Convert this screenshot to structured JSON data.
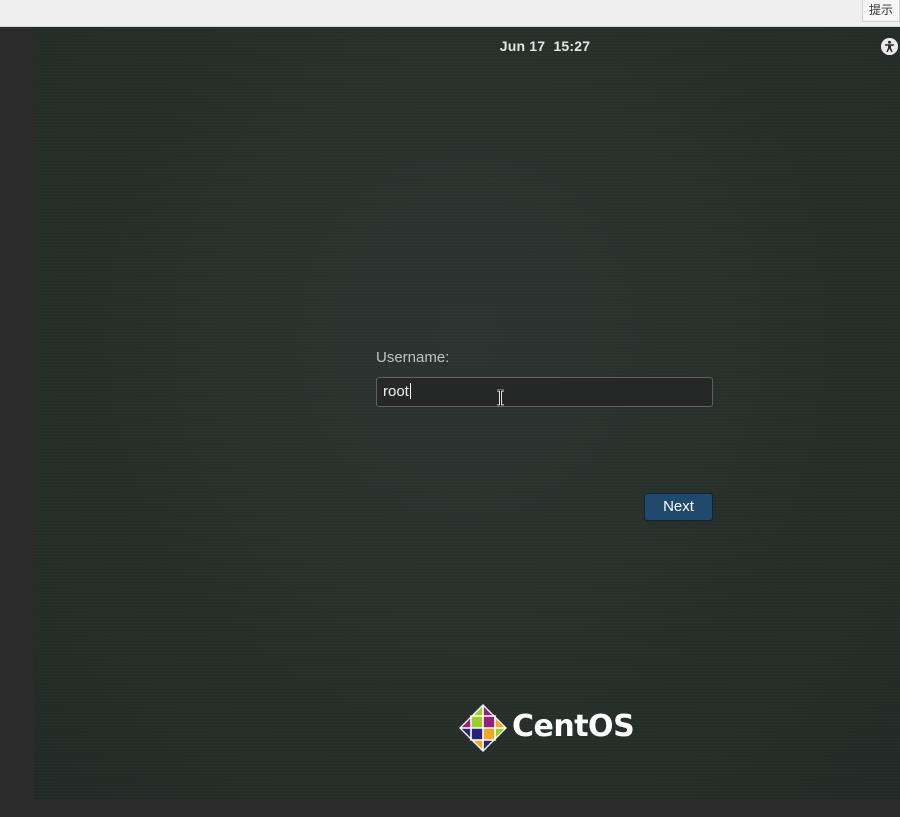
{
  "host_toolbar": {
    "hint_label": "提示"
  },
  "top_bar": {
    "clock": "Jun 17  15:27",
    "accessibility_icon": "accessibility-icon"
  },
  "login": {
    "username_label": "Username:",
    "username_value": "root",
    "next_label": "Next",
    "accent_color": "#1f4a6e"
  },
  "branding": {
    "logo_text": "CentOS",
    "logo_icon": "centos-logo-icon"
  }
}
